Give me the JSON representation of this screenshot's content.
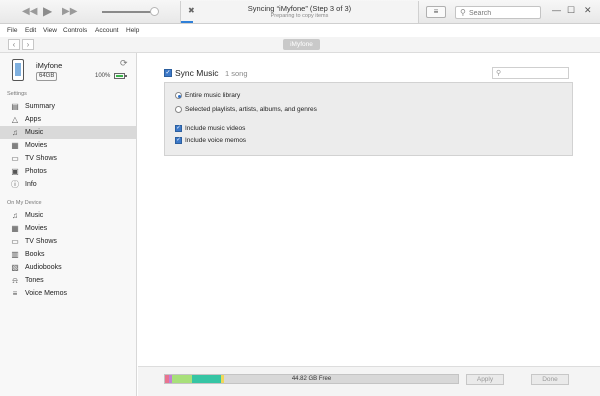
{
  "toolbar": {
    "rewind_icon": "rewind-icon",
    "play_icon": "play-icon",
    "forward_icon": "fast-forward-icon",
    "volume_level": 0.92,
    "status_title": "Syncing “iMyfone” (Step 3 of 3)",
    "status_sub": "Preparing to copy items",
    "sync_progress": 0.05,
    "search_placeholder": "Search"
  },
  "menu": [
    "File",
    "Edit",
    "View",
    "Controls",
    "Account",
    "Help"
  ],
  "navbar": {
    "device_button": "iMyfone"
  },
  "device": {
    "name": "iMyfone",
    "capacity": "64GB",
    "battery": "100%",
    "battery_level": 1.0
  },
  "sidebar": {
    "settings_header": "Settings",
    "settings_items": [
      {
        "label": "Summary",
        "icon": "summary-icon",
        "glyph": "▤"
      },
      {
        "label": "Apps",
        "icon": "apps-icon",
        "glyph": "△"
      },
      {
        "label": "Music",
        "icon": "music-icon",
        "glyph": "♫",
        "active": true
      },
      {
        "label": "Movies",
        "icon": "film-icon",
        "glyph": "▦"
      },
      {
        "label": "TV Shows",
        "icon": "tv-icon",
        "glyph": "▭"
      },
      {
        "label": "Photos",
        "icon": "camera-icon",
        "glyph": "▣"
      },
      {
        "label": "Info",
        "icon": "info-icon",
        "glyph": "ⓘ"
      }
    ],
    "device_header": "On My Device",
    "device_items": [
      {
        "label": "Music",
        "icon": "music-icon",
        "glyph": "♫"
      },
      {
        "label": "Movies",
        "icon": "film-icon",
        "glyph": "▦"
      },
      {
        "label": "TV Shows",
        "icon": "tv-icon",
        "glyph": "▭"
      },
      {
        "label": "Books",
        "icon": "book-icon",
        "glyph": "▥"
      },
      {
        "label": "Audiobooks",
        "icon": "audiobook-icon",
        "glyph": "▧"
      },
      {
        "label": "Tones",
        "icon": "bell-icon",
        "glyph": "⍾"
      },
      {
        "label": "Voice Memos",
        "icon": "voice-memo-icon",
        "glyph": "≡"
      }
    ]
  },
  "main": {
    "sync_label": "Sync Music",
    "sync_checked": true,
    "song_count": "1 song",
    "options": {
      "entire_library": "Entire music library",
      "selected_items": "Selected playlists, artists, albums, and genres",
      "include_videos": "Include music videos",
      "include_memos": "Include voice memos"
    }
  },
  "footer": {
    "storage_free": "44.82 GB Free",
    "storage_segments": [
      {
        "color": "#e9748f",
        "fraction": 0.012
      },
      {
        "color": "#c27fd6",
        "fraction": 0.012
      },
      {
        "color": "#a8e07a",
        "fraction": 0.067
      },
      {
        "color": "#36c5a4",
        "fraction": 0.1
      },
      {
        "color": "#f0d85a",
        "fraction": 0.01
      }
    ],
    "apply_button": "Apply",
    "done_button": "Done"
  }
}
